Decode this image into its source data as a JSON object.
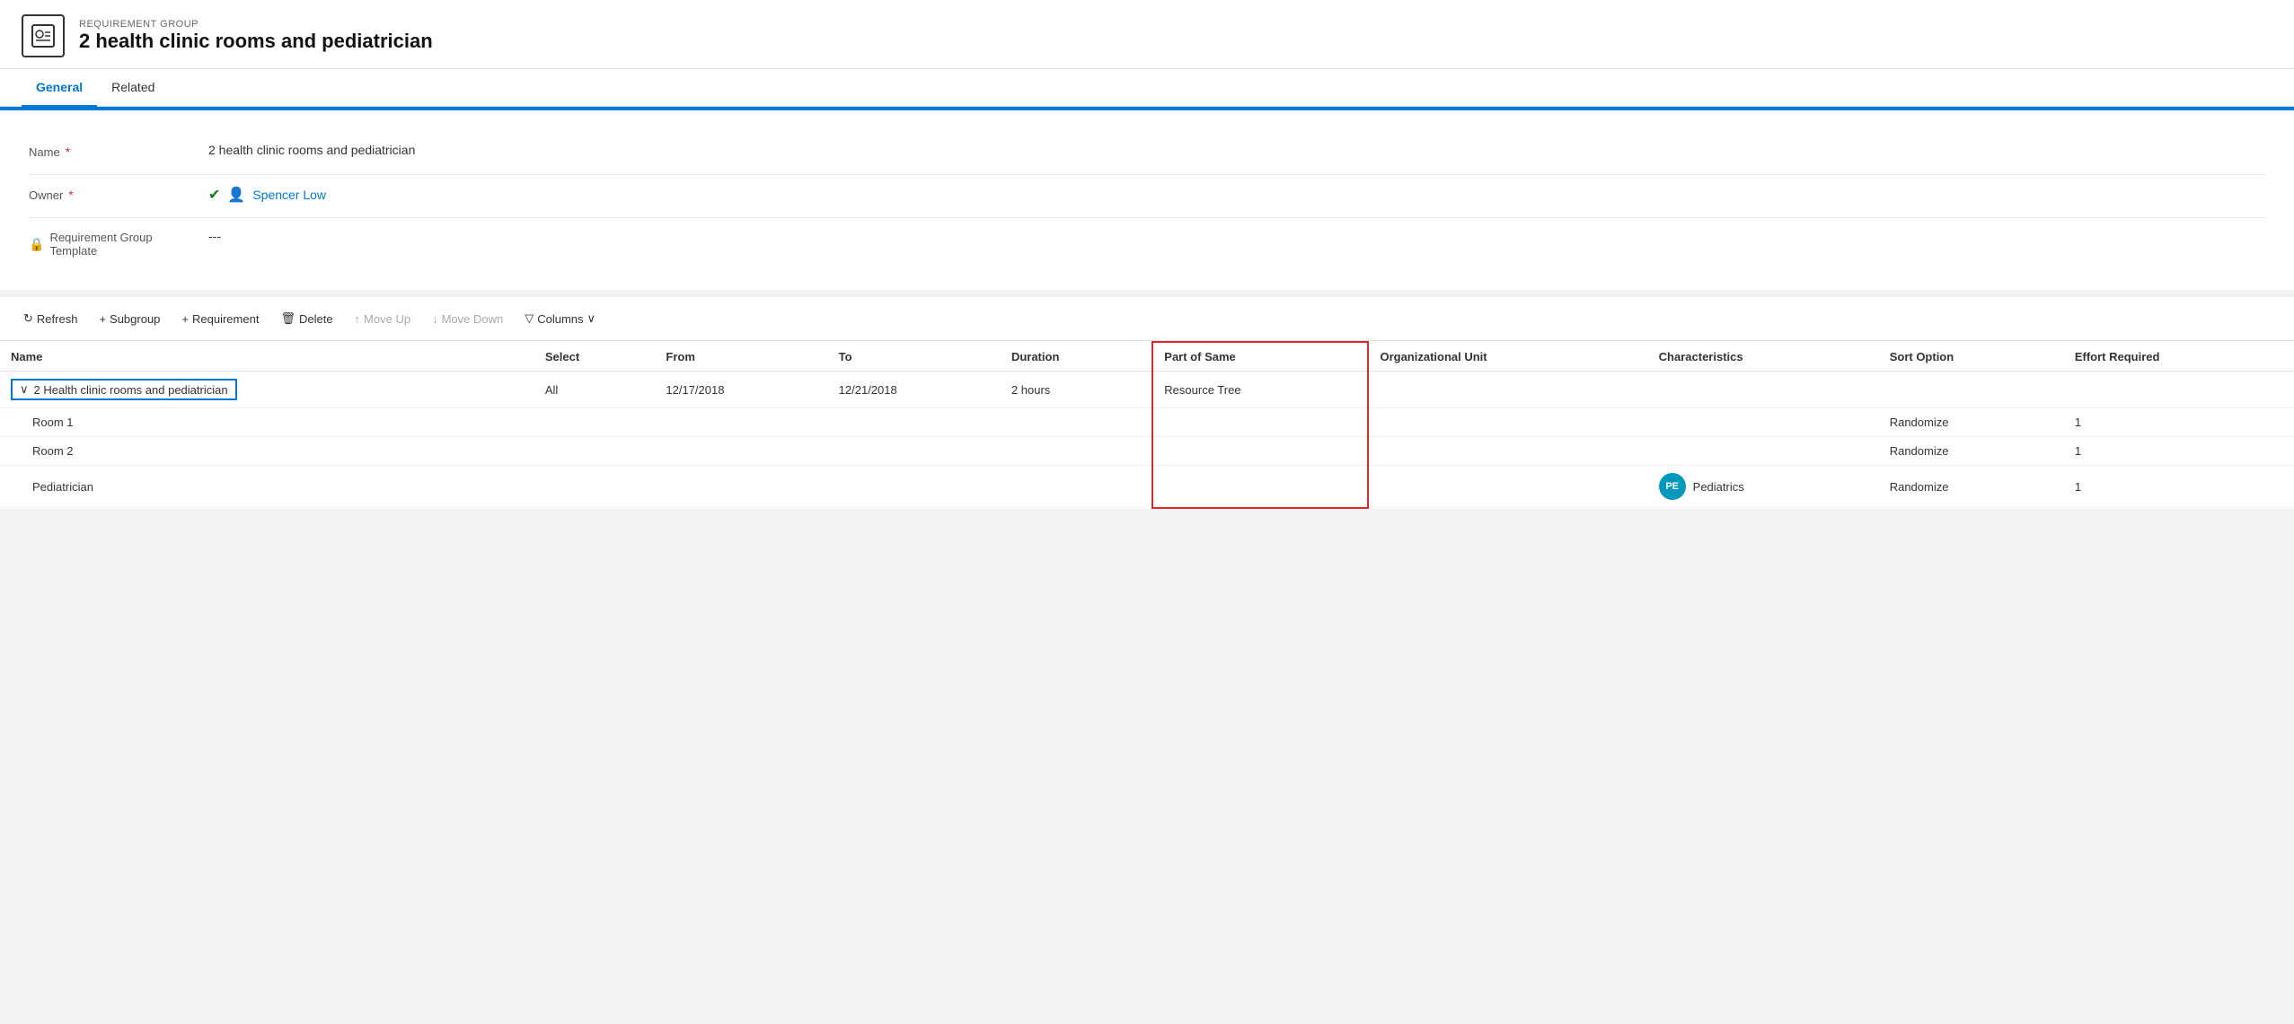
{
  "header": {
    "record_type": "REQUIREMENT GROUP",
    "title": "2 health clinic rooms and pediatrician",
    "icon_text": "📋"
  },
  "tabs": [
    {
      "label": "General",
      "active": true
    },
    {
      "label": "Related",
      "active": false
    }
  ],
  "form": {
    "fields": [
      {
        "label": "Name",
        "required": true,
        "value": "2 health clinic rooms and pediatrician",
        "type": "text"
      },
      {
        "label": "Owner",
        "required": true,
        "value": "Spencer Low",
        "type": "owner"
      },
      {
        "label": "Requirement Group Template",
        "required": false,
        "value": "---",
        "type": "text",
        "icon": "lock"
      }
    ]
  },
  "toolbar": {
    "refresh_label": "Refresh",
    "subgroup_label": "Subgroup",
    "requirement_label": "Requirement",
    "delete_label": "Delete",
    "move_up_label": "Move Up",
    "move_down_label": "Move Down",
    "columns_label": "Columns"
  },
  "grid": {
    "columns": [
      "Name",
      "Select",
      "From",
      "To",
      "Duration",
      "Part of Same",
      "Organizational Unit",
      "Characteristics",
      "Sort Option",
      "Effort Required"
    ],
    "rows": [
      {
        "name": "2 Health clinic rooms and pediatrician",
        "indent": 0,
        "expand": true,
        "selected": true,
        "select": "All",
        "from": "12/17/2018",
        "to": "12/21/2018",
        "duration": "2 hours",
        "part_of_same": "Resource Tree",
        "part_of_same_highlighted": true,
        "org_unit": "",
        "characteristics": "",
        "sort_option": "",
        "effort": ""
      },
      {
        "name": "Room 1",
        "indent": 1,
        "expand": false,
        "selected": false,
        "select": "",
        "from": "",
        "to": "",
        "duration": "",
        "part_of_same": "",
        "part_of_same_highlighted": false,
        "org_unit": "",
        "characteristics": "",
        "sort_option": "Randomize",
        "effort": "1"
      },
      {
        "name": "Room 2",
        "indent": 1,
        "expand": false,
        "selected": false,
        "select": "",
        "from": "",
        "to": "",
        "duration": "",
        "part_of_same": "",
        "part_of_same_highlighted": false,
        "org_unit": "",
        "characteristics": "",
        "sort_option": "Randomize",
        "effort": "1"
      },
      {
        "name": "Pediatrician",
        "indent": 1,
        "expand": false,
        "selected": false,
        "select": "",
        "from": "",
        "to": "",
        "duration": "",
        "part_of_same": "",
        "part_of_same_highlighted": false,
        "org_unit": "",
        "characteristics_badge": "PE",
        "characteristics": "Pediatrics",
        "sort_option": "Randomize",
        "effort": "1"
      }
    ]
  }
}
